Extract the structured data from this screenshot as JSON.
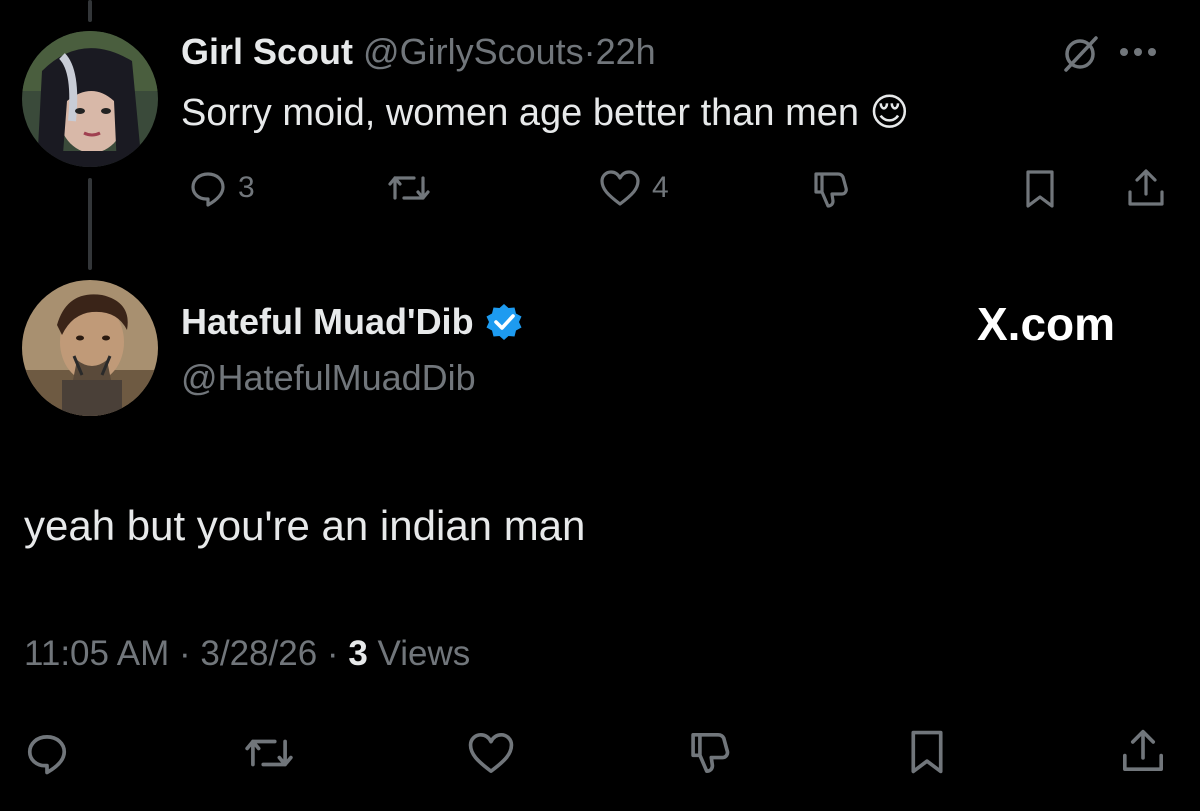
{
  "parent_tweet": {
    "display_name": "Girl Scout",
    "handle": "@GirlyScouts",
    "separator": "·",
    "time_ago": "22h",
    "text": "Sorry moid, women age better than men 😌",
    "actions": {
      "reply_count": "3",
      "like_count": "4"
    }
  },
  "reply_tweet": {
    "display_name": "Hateful Muad'Dib",
    "handle": "@HatefulMuadDib",
    "watermark": "X.com",
    "text": "yeah but you're an indian man",
    "meta": {
      "time": "11:05 AM",
      "sep1": "·",
      "date": "3/28/26",
      "sep2": "·",
      "views_count": "3",
      "views_label": "Views"
    }
  },
  "colors": {
    "background": "#000000",
    "text_primary": "#e7e9ea",
    "text_secondary": "#71767b",
    "verified_blue": "#1d9bf0"
  }
}
